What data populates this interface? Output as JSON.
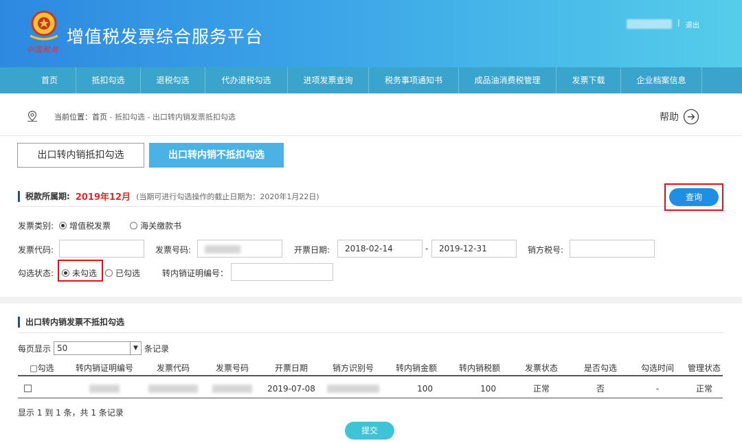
{
  "header": {
    "emblem_caption": "中国税务",
    "title": "增值税发票综合服务平台",
    "user_separator": "|",
    "logout_label": "退出"
  },
  "nav": {
    "items": [
      {
        "label": "首页"
      },
      {
        "label": "抵扣勾选"
      },
      {
        "label": "退税勾选"
      },
      {
        "label": "代办退税勾选"
      },
      {
        "label": "进项发票查询"
      },
      {
        "label": "税务事项通知书"
      },
      {
        "label": "成品油消费税管理"
      },
      {
        "label": "发票下载"
      },
      {
        "label": "企业档案信息"
      }
    ]
  },
  "breadcrumb": {
    "prefix": "当前位置：",
    "home": "首页",
    "path": " - 抵扣勾选 - 出口转内销发票抵扣勾选"
  },
  "help_label": "帮助",
  "tabs": {
    "a": "出口转内销抵扣勾选",
    "b": "出口转内销不抵扣勾选"
  },
  "period": {
    "label": "税款所属期:",
    "value": "2019年12月",
    "note": "(当期可进行勾选操作的截止日期为：2020年1月22日)"
  },
  "query_label": "查询",
  "filters": {
    "invoice_type_label": "发票类别:",
    "type_options": [
      "增值税发票",
      "海关缴款书"
    ],
    "invoice_code_label": "发票代码:",
    "invoice_number_label": "发票号码:",
    "issue_date_label": "开票日期:",
    "date_from": "2018-02-14",
    "date_to": "2019-12-31",
    "date_sep": "-",
    "seller_tax_label": "销方税号:",
    "status_label": "勾选状态:",
    "status_options": [
      "未勾选",
      "已勾选"
    ],
    "cert_number_label": "转内销证明编号："
  },
  "section2": {
    "title": "出口转内销发票不抵扣勾选",
    "per_page_label": "每页显示",
    "per_page_value": "50",
    "records_label": "条记录"
  },
  "table": {
    "headers": [
      "□勾选",
      "转内销证明编号",
      "发票代码",
      "发票号码",
      "开票日期",
      "销方识别号",
      "转内销金额",
      "转内销税额",
      "发票状态",
      "是否勾选",
      "勾选时间",
      "管理状态"
    ],
    "rows": [
      {
        "date": "2019-07-08",
        "amount": "100",
        "tax": "100",
        "invoice_status": "正常",
        "checked": "否",
        "check_time": "-",
        "manage_status": "正常"
      }
    ]
  },
  "summary": "显示 1 到 1 条，共 1 条记录",
  "submit_label": "提交",
  "colors": {
    "header_start": "#2e88e0",
    "header_end": "#56cdea",
    "nav": "#3ba4cc",
    "active_tab": "#4bb2e6",
    "query_button": "#1f8fe6",
    "submit_button": "#3fc3d6",
    "period_value": "#d32f2f",
    "highlight": "#d8141b"
  }
}
